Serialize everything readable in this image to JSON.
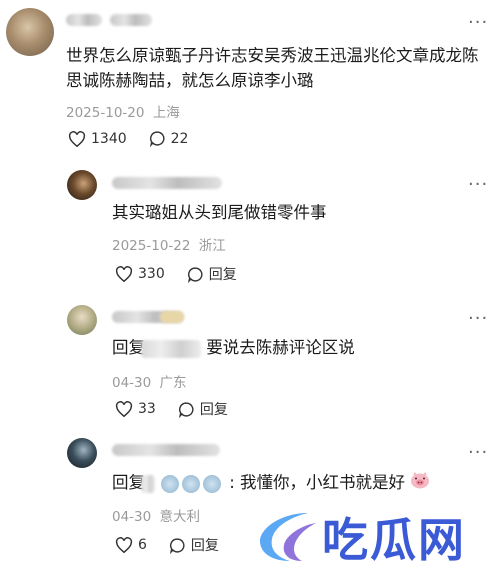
{
  "comments": [
    {
      "text": "世界怎么原谅甄子丹许志安吴秀波王迅温兆伦文章成龙陈思诚陈赫陶喆，就怎么原谅李小璐",
      "date": "2025-10-20",
      "location": "上海",
      "likes": "1340",
      "replies": "22"
    },
    {
      "text": "其实璐姐从头到尾做错零件事",
      "date": "2025-10-22",
      "location": "浙江",
      "likes": "330",
      "reply_label": "回复"
    },
    {
      "reply_prefix": "回复",
      "text": "要说去陈赫评论区说",
      "date": "04-30",
      "location": "广东",
      "likes": "33",
      "reply_label": "回复"
    },
    {
      "reply_prefix": "回复",
      "text": ": 我懂你，小红书就是好",
      "date": "04-30",
      "location": "意大利",
      "likes": "6",
      "reply_label": "回复"
    }
  ],
  "more_label": "···",
  "watermark": {
    "text": "吃瓜网",
    "color": "#3b5bd6",
    "accent": "#5ba8f5"
  },
  "icons": {
    "like": "heart-outline-icon",
    "comment": "speech-bubble-icon",
    "more": "more-dots-icon"
  }
}
